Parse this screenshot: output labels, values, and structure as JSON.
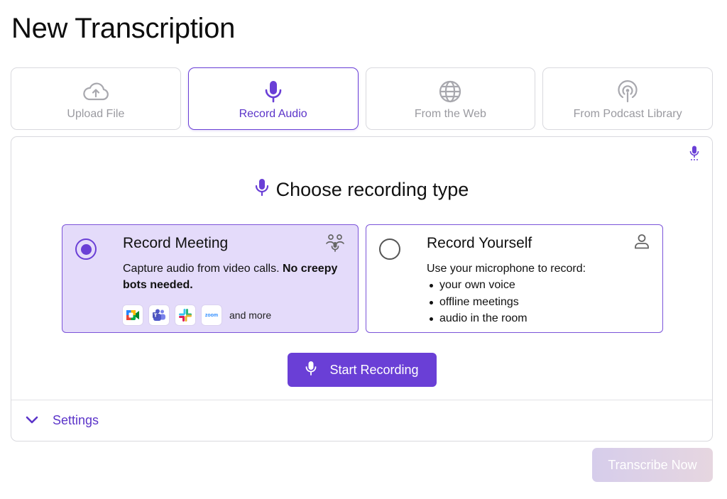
{
  "page": {
    "title": "New Transcription"
  },
  "tabs": [
    {
      "label": "Upload File",
      "icon": "cloud-upload-icon",
      "active": false
    },
    {
      "label": "Record Audio",
      "icon": "microphone-icon",
      "active": true
    },
    {
      "label": "From the Web",
      "icon": "globe-icon",
      "active": false
    },
    {
      "label": "From Podcast Library",
      "icon": "podcast-icon",
      "active": false
    }
  ],
  "recording": {
    "heading": "Choose recording type",
    "meeting": {
      "title": "Record Meeting",
      "desc_plain": "Capture audio from video calls. ",
      "desc_bold": "No creepy bots needed.",
      "selected": true,
      "apps": [
        "google-meet-icon",
        "teams-icon",
        "slack-icon",
        "zoom-icon"
      ],
      "zoom_text": "zoom",
      "and_more": "and more"
    },
    "yourself": {
      "title": "Record Yourself",
      "desc": "Use your microphone to record:",
      "bullets": [
        "your own voice",
        "offline meetings",
        "audio in the room"
      ],
      "selected": false
    },
    "start_label": "Start Recording"
  },
  "settings": {
    "label": "Settings"
  },
  "transcribe": {
    "label": "Transcribe Now"
  },
  "colors": {
    "accent": "#6a3fd6",
    "selected_card": "#e4dbfa",
    "border": "#d9d9de",
    "inactive": "#9a9aa0"
  }
}
